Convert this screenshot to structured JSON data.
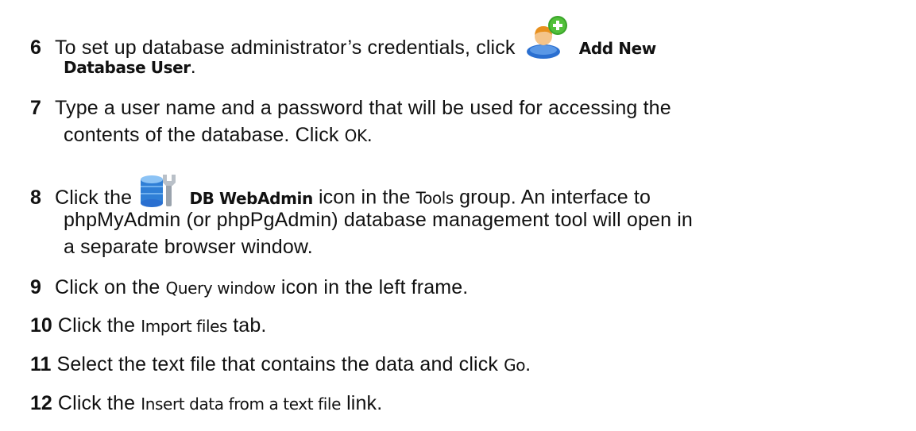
{
  "steps": [
    {
      "number": "6",
      "pre": "To set up database administrator’s credentials, click",
      "icon": "add-user-icon",
      "ui": "Add New",
      "ui_line2": "Database User",
      "post": "."
    },
    {
      "number": "7",
      "line1": "Type a user name and a password that will be used for accessing the",
      "line2_pre": "contents of the database. Click",
      "ui": "OK",
      "post": "."
    },
    {
      "number": "8",
      "pre": "Click the",
      "icon": "db-webadmin-icon",
      "ui": "DB WebAdmin",
      "mid": "icon in the",
      "ui2": "Tools",
      "post": "group. An interface to",
      "line2": "phpMyAdmin (or phpPgAdmin) database management tool will open in",
      "line3": "a separate browser window."
    },
    {
      "number": "9",
      "pre": "Click on the",
      "ui": "Query window",
      "post": "icon in the left frame."
    },
    {
      "number": "10",
      "pre": "Click the",
      "ui": "Import files",
      "post": "tab."
    },
    {
      "number": "11",
      "pre": "Select the text file that contains the data and click",
      "ui": "Go",
      "post": "."
    },
    {
      "number": "12",
      "pre": "Click the",
      "ui": "Insert data from a text file",
      "post": "link."
    }
  ],
  "colors": {
    "text": "#111111",
    "background": "#ffffff",
    "icon_green": "#3aa52a",
    "icon_orange": "#f0a020",
    "icon_blue": "#2a6fd0"
  }
}
